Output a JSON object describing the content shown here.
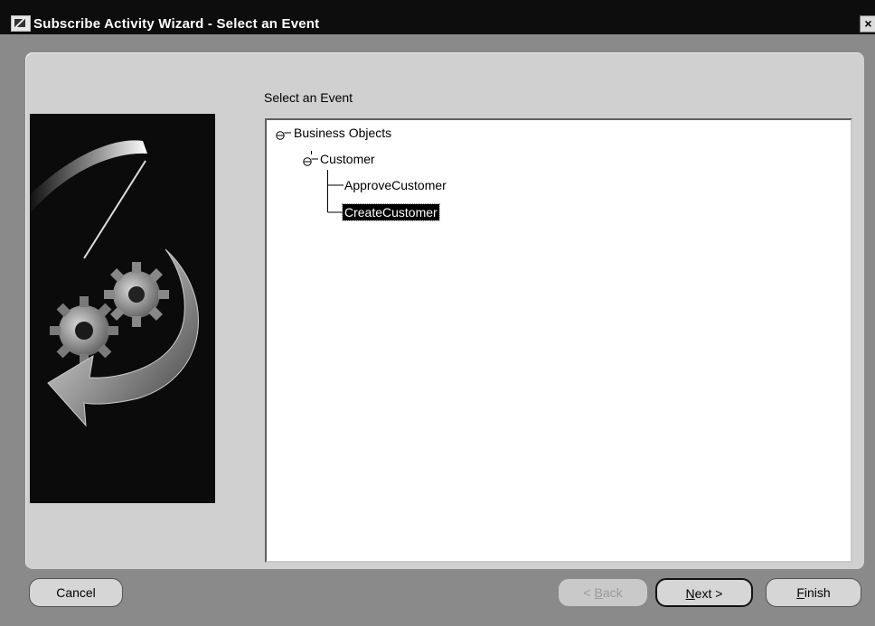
{
  "window": {
    "title": "Subscribe Activity Wizard - Select an Event",
    "close_label": "×",
    "app_icon": "wizard-app-icon"
  },
  "panel": {
    "section_title": "Select an Event"
  },
  "tree": {
    "nodes": [
      {
        "label": "Business Objects",
        "expanded": true,
        "level": 0
      },
      {
        "label": "Customer",
        "expanded": true,
        "level": 1
      },
      {
        "label": "ApproveCustomer",
        "level": 2
      },
      {
        "label": "CreateCustomer",
        "level": 2,
        "selected": true
      }
    ]
  },
  "buttons": {
    "cancel": "Cancel",
    "back": {
      "mnemonic": "B",
      "rest": "ack",
      "enabled": false
    },
    "next": {
      "mnemonic": "N",
      "rest": "ext",
      "default": true
    },
    "finish": {
      "mnemonic": "F",
      "rest": "inish"
    }
  },
  "colors": {
    "titlebar": "#0d0d0d",
    "panel": "#d0d0d0",
    "selection": "#000000"
  }
}
